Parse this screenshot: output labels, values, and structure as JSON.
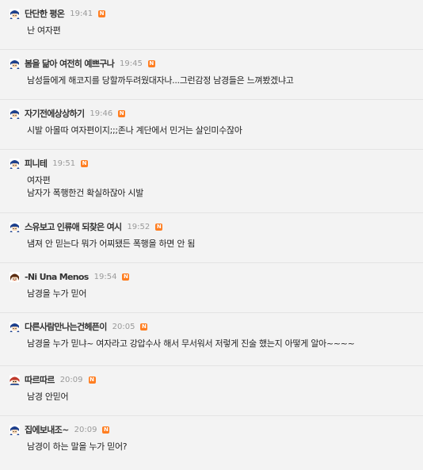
{
  "comments": [
    {
      "nick": "단단한 평온",
      "time": "19:41",
      "badge": "N",
      "lines": [
        "난 여자편"
      ],
      "avatar": "avatar-blue-hair-icon"
    },
    {
      "nick": "봄을 닮아 여전히 예쁘구나",
      "time": "19:45",
      "badge": "N",
      "lines": [
        "남성들에게 해코지를 당할까두려웠대자나...그런감정 남경들은 느껴봤겠냐고"
      ],
      "avatar": "avatar-blue-hair-icon"
    },
    {
      "nick": "자기전에상상하기",
      "time": "19:46",
      "badge": "N",
      "lines": [
        "시발 아몰따 여자편이지;;;존나 계단에서 민거는 살인미수잖아"
      ],
      "avatar": "avatar-blue-hair-icon"
    },
    {
      "nick": "피니테",
      "time": "19:51",
      "badge": "N",
      "lines": [
        "여자편",
        "남자가 폭행한건 확실하잖아 시발"
      ],
      "avatar": "avatar-blue-hair-icon"
    },
    {
      "nick": "스유보고 인류애 되찾은 여시",
      "time": "19:52",
      "badge": "N",
      "lines": [
        "냄져 안 믿는다 뭐가 어찌됐든 폭행을 하면 안 됨"
      ],
      "avatar": "avatar-blue-hair-icon"
    },
    {
      "nick": "-Ni Una Menos",
      "time": "19:54",
      "badge": "N",
      "lines": [
        "남경을 누가 믿어"
      ],
      "avatar": "avatar-brown-hair-icon"
    },
    {
      "nick": "다른사람만나는건헤픈이",
      "time": "20:05",
      "badge": "N",
      "lines": [
        "남경을 누가 믿냐~ 여자라고 강압수사 해서 무서워서 저렇게 진술 했는지 아떻게 알아~~~~"
      ],
      "avatar": "avatar-blue-hair-icon"
    },
    {
      "nick": "따르따르",
      "time": "20:09",
      "badge": "N",
      "lines": [
        "남경 안믿어"
      ],
      "avatar": "avatar-red-hair-icon"
    },
    {
      "nick": "집에보내조~",
      "time": "20:09",
      "badge": "N",
      "lines": [
        "남경이 하는 말을 누가 믿어?"
      ],
      "avatar": "avatar-blue-hair-icon"
    }
  ],
  "colors": {
    "background": "#f3f3f3",
    "badge": "#ff7e21",
    "time": "#9a9a9a",
    "nick": "#333333"
  }
}
